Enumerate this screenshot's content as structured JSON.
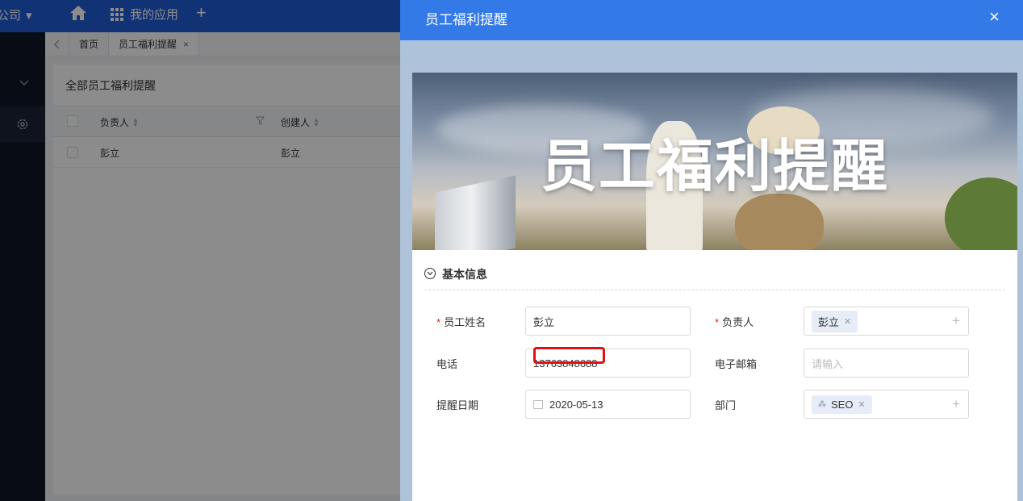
{
  "topbar": {
    "company": "公司",
    "company_caret": "▾",
    "home_icon": "⌂",
    "apps_label": "我的应用",
    "plus": "+"
  },
  "tabs": [
    {
      "label": "首页",
      "active": false
    },
    {
      "label": "员工福利提醒",
      "active": true,
      "close": "×"
    }
  ],
  "list": {
    "title": "全部员工福利提醒",
    "columns": [
      "负责人",
      "创建人"
    ],
    "rows": [
      {
        "owner": "彭立",
        "creator": "彭立"
      }
    ]
  },
  "drawer": {
    "title": "员工福利提醒",
    "close": "×",
    "banner_title": "员工福利提醒",
    "section_title": "基本信息",
    "fields": {
      "name": {
        "label": "员工姓名",
        "value": "彭立",
        "required": "*"
      },
      "owner": {
        "label": "负责人",
        "tag": "彭立",
        "required": "*"
      },
      "phone": {
        "label": "电话",
        "value": "13763848688"
      },
      "email": {
        "label": "电子邮箱",
        "placeholder": "请输入"
      },
      "date": {
        "label": "提醒日期",
        "value": "2020-05-13"
      },
      "dept": {
        "label": "部门",
        "tag": "SEO"
      }
    }
  },
  "colors": {
    "topbar": "#1f5bd6",
    "drawer_header": "#3479e8",
    "drawer_bg": "#aec3d9",
    "highlight": "#e21010"
  }
}
